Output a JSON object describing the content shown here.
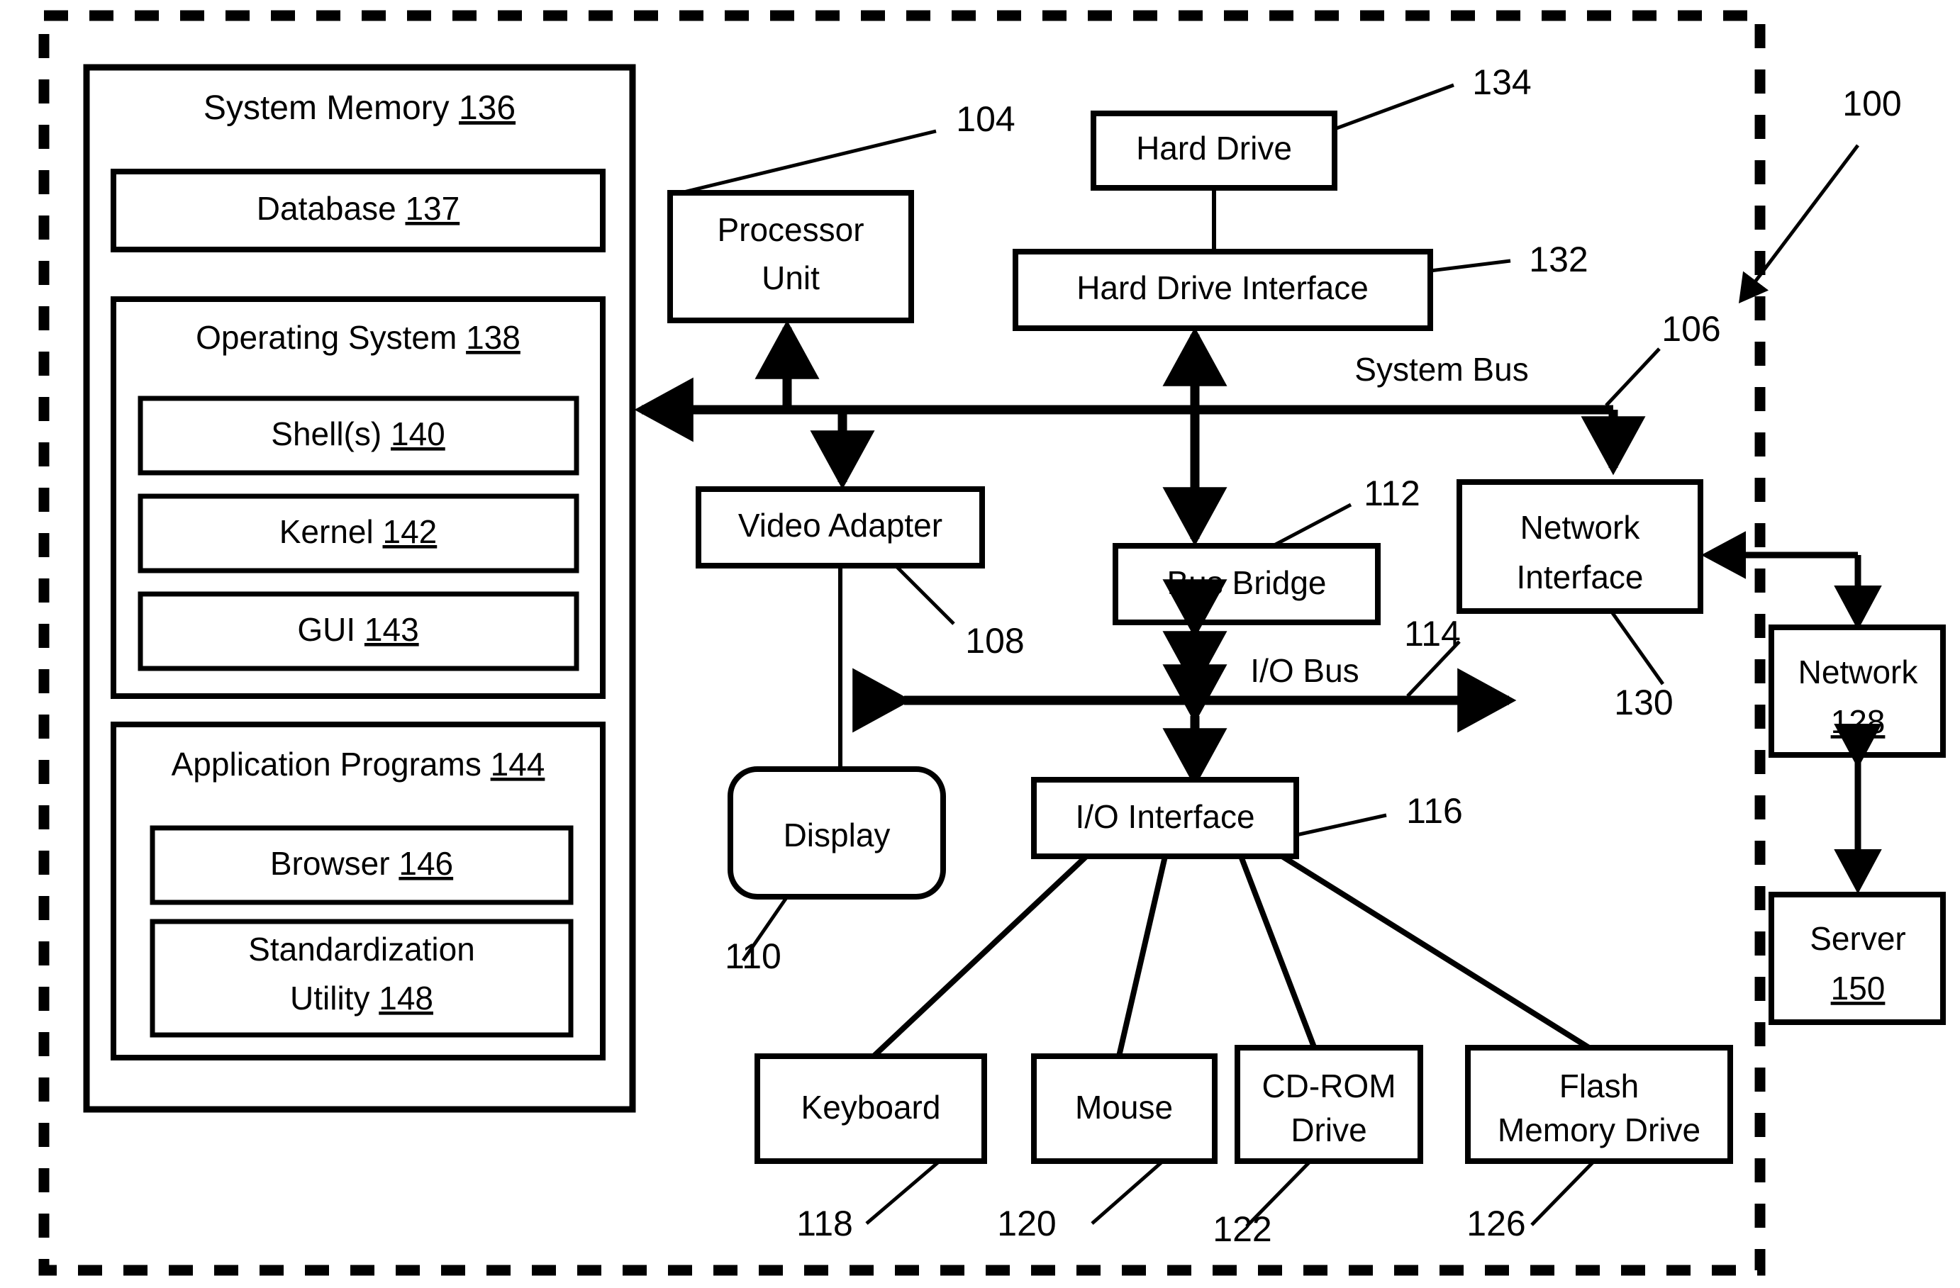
{
  "figure": {
    "system_ref": "100",
    "memory": {
      "title_text": "System Memory",
      "title_ref": "136",
      "database_text": "Database",
      "database_ref": "137",
      "os_text": "Operating System",
      "os_ref": "138",
      "shell_text": "Shell(s)",
      "shell_ref": "140",
      "kernel_text": "Kernel",
      "kernel_ref": "142",
      "gui_text": "GUI",
      "gui_ref": "143",
      "apps_text": "Application Programs",
      "apps_ref": "144",
      "browser_text": "Browser",
      "browser_ref": "146",
      "util_line1": "Standardization",
      "util_line2": "Utility",
      "util_ref": "148"
    },
    "blocks": {
      "processor_line1": "Processor",
      "processor_line2": "Unit",
      "processor_ref": "104",
      "hard_drive": "Hard Drive",
      "hard_drive_ref": "134",
      "hd_interface": "Hard Drive Interface",
      "hd_interface_ref": "132",
      "video_adapter": "Video Adapter",
      "video_adapter_ref": "108",
      "display": "Display",
      "display_ref": "110",
      "bus_bridge": "Bus Bridge",
      "bus_bridge_ref": "112",
      "network_interface_line1": "Network",
      "network_interface_line2": "Interface",
      "network_interface_ref": "130",
      "io_interface": "I/O Interface",
      "io_interface_ref": "116",
      "keyboard": "Keyboard",
      "keyboard_ref": "118",
      "mouse": "Mouse",
      "mouse_ref": "120",
      "cdrom_line1": "CD-ROM",
      "cdrom_line2": "Drive",
      "cdrom_ref": "122",
      "flash_line1": "Flash",
      "flash_line2": "Memory Drive",
      "flash_ref": "126",
      "network_text": "Network",
      "network_ref": "128",
      "server_text": "Server",
      "server_ref": "150"
    },
    "buses": {
      "system_bus_label": "System Bus",
      "system_bus_ref": "106",
      "io_bus_label": "I/O Bus",
      "io_bus_ref": "114"
    }
  }
}
